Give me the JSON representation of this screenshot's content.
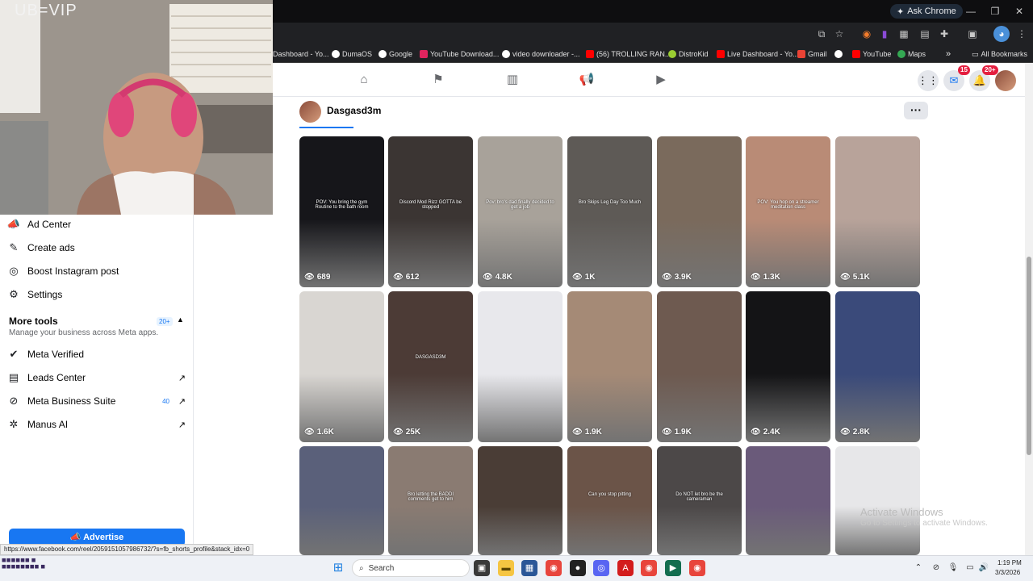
{
  "browser": {
    "ask_chrome": "Ask Chrome",
    "bookmarks": [
      {
        "label": "Dashboard - Yo...",
        "color": "#ff0000"
      },
      {
        "label": "DumaOS",
        "color": "#ffffff"
      },
      {
        "label": "Google",
        "color": "#ffffff"
      },
      {
        "label": "YouTube Download...",
        "color": "#e0245e"
      },
      {
        "label": "video downloader -...",
        "color": "#ffffff"
      },
      {
        "label": "(56) TROLLING RAN...",
        "color": "#ff0000"
      },
      {
        "label": "DistroKid",
        "color": "#9acd32"
      },
      {
        "label": "Live Dashboard - Yo...",
        "color": "#ff0000"
      },
      {
        "label": "Gmail",
        "color": "#ea4335"
      },
      {
        "label": "",
        "color": "#ffffff"
      },
      {
        "label": "YouTube",
        "color": "#ff0000"
      },
      {
        "label": "Maps",
        "color": "#34a853"
      }
    ],
    "all_bookmarks": "All Bookmarks",
    "status_url": "https://www.facebook.com/reel/2059151057986732/?s=fb_shorts_profile&stack_idx=0"
  },
  "webcam": {
    "label": "UB=VIP"
  },
  "facebook": {
    "messenger_badge": "15",
    "notifications_badge": "20+",
    "profile_name": "Dasgasd3m"
  },
  "sidebar": {
    "items_top": [
      {
        "label": "Ad Center",
        "icon": "megaphone-icon"
      },
      {
        "label": "Create ads",
        "icon": "edit-icon"
      },
      {
        "label": "Boost Instagram post",
        "icon": "instagram-icon"
      },
      {
        "label": "Settings",
        "icon": "gear-icon"
      }
    ],
    "more_tools": {
      "title": "More tools",
      "badge": "20+",
      "subtitle": "Manage your business across Meta apps."
    },
    "items_tools": [
      {
        "label": "Meta Verified",
        "badge": "",
        "external": false
      },
      {
        "label": "Leads Center",
        "badge": "",
        "external": true
      },
      {
        "label": "Meta Business Suite",
        "badge": "40",
        "external": true
      },
      {
        "label": "Manus AI",
        "badge": "",
        "external": true
      }
    ],
    "advertise_label": "Advertise"
  },
  "reels": {
    "row1": [
      {
        "views": "689",
        "caption": "POV: You bring the gym Routine to the bath room",
        "bg": "#16161a"
      },
      {
        "views": "612",
        "caption": "Discord Mod Rizz GOTTA be stopped",
        "bg": "#3b3533"
      },
      {
        "views": "4.8K",
        "caption": "Pov: bro's dad finally decided to get a job",
        "bg": "#a8a29a"
      },
      {
        "views": "1K",
        "caption": "Bro Skips Leg Day Too Much",
        "bg": "#5e5a56"
      },
      {
        "views": "3.9K",
        "caption": "",
        "bg": "#7a6a5c"
      },
      {
        "views": "1.3K",
        "caption": "POV: You hop on a streamer meditation class",
        "bg": "#b98b76"
      },
      {
        "views": "5.1K",
        "caption": "",
        "bg": "#b8a39a"
      }
    ],
    "row2": [
      {
        "views": "1.6K",
        "caption": "",
        "bg": "#d9d6d2"
      },
      {
        "views": "25K",
        "caption": "DASGASD3M",
        "bg": "#4c3b36"
      },
      {
        "views": "",
        "caption": "",
        "bg": "#e8e8ec"
      },
      {
        "views": "1.9K",
        "caption": "",
        "bg": "#a58a76"
      },
      {
        "views": "1.9K",
        "caption": "",
        "bg": "#6e5a50"
      },
      {
        "views": "2.4K",
        "caption": "",
        "bg": "#141416"
      },
      {
        "views": "2.8K",
        "caption": "",
        "bg": "#3a4a7a"
      }
    ],
    "row3": [
      {
        "caption": "",
        "bg": "#5a607a"
      },
      {
        "caption": "Bro letting the BADDI comments get to him",
        "bg": "#8a7b72"
      },
      {
        "caption": "",
        "bg": "#4a3d36"
      },
      {
        "caption": "Can you stop pitting",
        "bg": "#6b5448"
      },
      {
        "caption": "Do NOT let bro be the cameraman",
        "bg": "#4c4848"
      },
      {
        "caption": "",
        "bg": "#6a5a7a"
      },
      {
        "caption": "",
        "bg": "#e7e7e9"
      }
    ]
  },
  "windows": {
    "activate_title": "Activate Windows",
    "activate_sub": "Go to Settings to activate Windows.",
    "search_placeholder": "Search",
    "time": "1:19 PM",
    "date": "3/3/2026"
  }
}
